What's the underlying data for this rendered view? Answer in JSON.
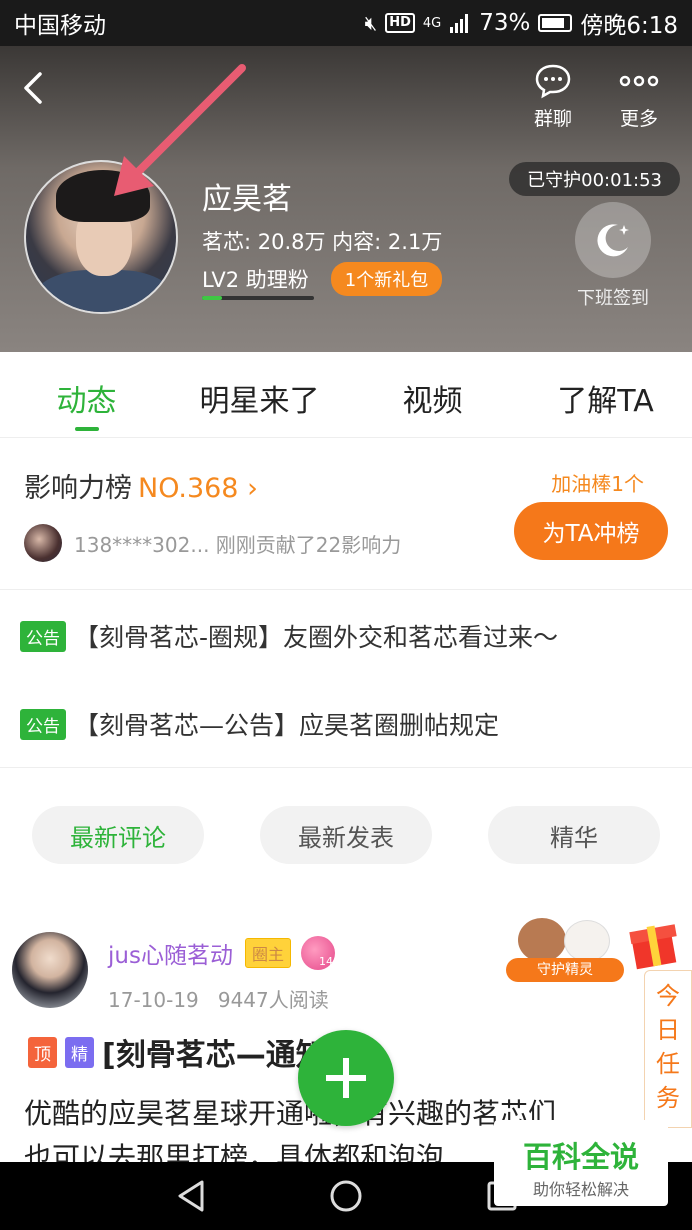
{
  "status_bar": {
    "carrier": "中国移动",
    "hd": "HD",
    "network": "4G",
    "battery": "73%",
    "time": "傍晚6:18"
  },
  "header": {
    "group_chat_label": "群聊",
    "more_label": "更多",
    "star_name": "应昊茗",
    "stats": "茗芯: 20.8万 内容: 2.1万",
    "level": "LV2 助理粉",
    "level_progress": 0.18,
    "gift_badge": "1个新礼包",
    "guard_time": "已守护00:01:53",
    "checkin_label": "下班签到"
  },
  "tabs": [
    {
      "label": "动态",
      "active": true
    },
    {
      "label": "明星来了",
      "active": false
    },
    {
      "label": "视频",
      "active": false
    },
    {
      "label": "了解TA",
      "active": false
    }
  ],
  "influence": {
    "title": "影响力榜",
    "rank": "NO.368",
    "contributor": "138****302... 刚刚贡献了22影响力",
    "cheer_count": "加油棒1个",
    "rush_button": "为TA冲榜"
  },
  "notices": [
    {
      "tag": "公告",
      "text": "【刻骨茗芯-圈规】友圈外交和茗芯看过来～"
    },
    {
      "tag": "公告",
      "text": "【刻骨茗芯—公告】应昊茗圈删帖规定"
    }
  ],
  "filters": [
    {
      "label": "最新评论",
      "active": true
    },
    {
      "label": "最新发表",
      "active": false
    },
    {
      "label": "精华",
      "active": false
    }
  ],
  "post": {
    "author": "jus心随茗动",
    "owner_tag": "圈主",
    "level_badge": "14",
    "date": "17-10-19",
    "reads": "9447人阅读",
    "top_tag": "顶",
    "essence_tag": "精",
    "title": "[刻骨茗芯—通知",
    "body_line1": "优酷的应昊茗星球开通啦，有兴趣的茗芯们",
    "body_line2": "也可以去那里打榜，具体都和泡泡"
  },
  "guard_sprite_label": "守护精灵",
  "today_task": [
    "今",
    "日",
    "任",
    "务"
  ],
  "watermark": {
    "title": "百科全说",
    "subtitle": "助你轻松解决"
  },
  "colors": {
    "accent_green": "#2eb33a",
    "accent_orange": "#f5781a"
  }
}
